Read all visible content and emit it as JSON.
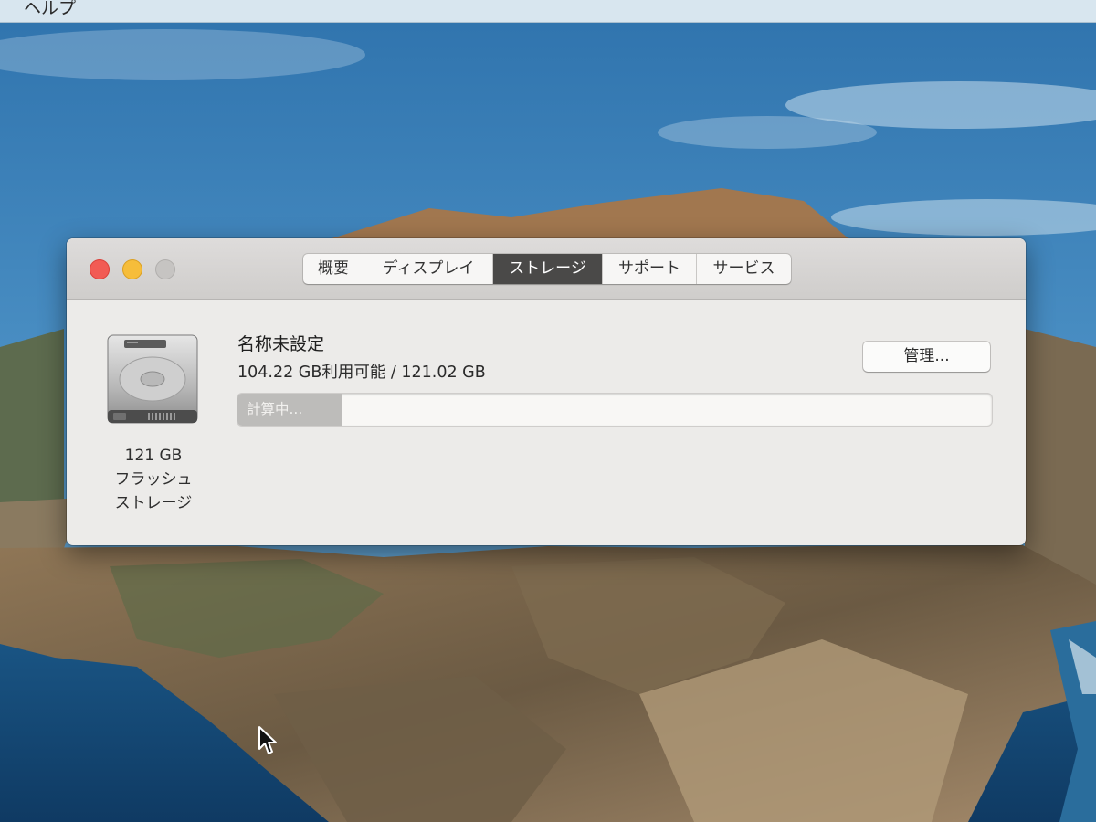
{
  "desktop": {
    "menubar_item": "ヘルプ"
  },
  "window": {
    "tabs": [
      {
        "label": "概要",
        "active": false
      },
      {
        "label": "ディスプレイ",
        "active": false
      },
      {
        "label": "ストレージ",
        "active": true
      },
      {
        "label": "サポート",
        "active": false
      },
      {
        "label": "サービス",
        "active": false
      }
    ],
    "disk": {
      "icon": "hard-disk-icon",
      "caption_size": "121 GB",
      "caption_type_line1": "フラッシュ",
      "caption_type_line2": "ストレージ"
    },
    "volume": {
      "name": "名称未設定",
      "capacity": "104.22 GB利用可能 / 121.02 GB"
    },
    "manage_button_label": "管理...",
    "storage_bar": {
      "status_label": "計算中...",
      "fill_fraction": 0.138
    },
    "colors": {
      "close": "#f25b54",
      "minimize": "#f6bd3a",
      "zoom": "#c6c4c2",
      "active_tab": "#4a4948"
    }
  }
}
